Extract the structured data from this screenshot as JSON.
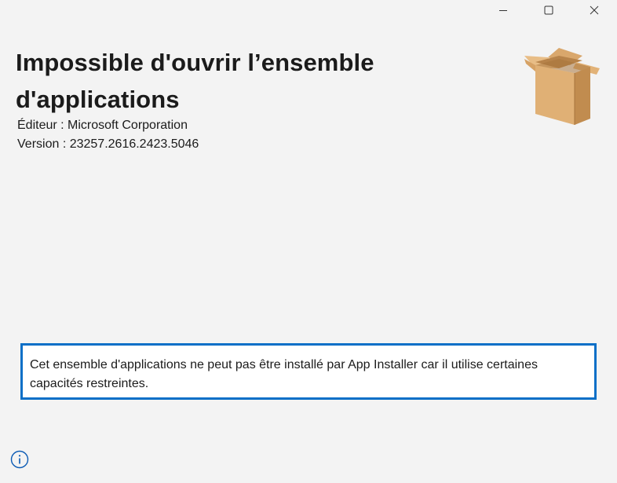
{
  "window": {
    "controls": {
      "minimize_icon": "minimize-icon",
      "maximize_icon": "maximize-icon",
      "close_icon": "close-icon"
    }
  },
  "header": {
    "title": "Impossible d'ouvrir l’ensemble d'applications",
    "publisher": "Éditeur : Microsoft Corporation",
    "version": "Version : 23257.2616.2423.5046",
    "package_icon": "open-cardboard-box-icon"
  },
  "message": {
    "text": "Cet ensemble d'applications ne peut pas être installé par App Installer car il utilise certaines capacités restreintes.",
    "border_color": "#0a6fc7"
  },
  "footer": {
    "info_icon": "info-icon",
    "accent_color": "#0a5ab4"
  }
}
